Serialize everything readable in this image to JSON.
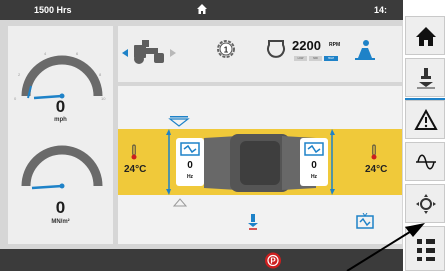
{
  "status_bar": {
    "hours": "1500 Hrs",
    "time": "14:"
  },
  "gauges": {
    "speed": {
      "value": "0",
      "unit": "mph",
      "ticks": [
        "0",
        "2",
        "4",
        "6",
        "8",
        "10"
      ]
    },
    "pressure": {
      "value": "0",
      "unit": "MN/m²"
    }
  },
  "top_panel": {
    "rpm_value": "2200",
    "rpm_unit": "RPM",
    "gear": "1",
    "speed_modes": [
      "LOW",
      "MID",
      "HIGH"
    ]
  },
  "drums": {
    "left": {
      "temp": "24°C",
      "freq": "0",
      "freq_unit": "Hz"
    },
    "right": {
      "temp": "24°C",
      "freq": "0",
      "freq_unit": "Hz"
    }
  },
  "colors": {
    "accent": "#1e82c8",
    "drum_band": "#f0c93a",
    "warning": "#cc1f1f",
    "bar": "#3b3b3b"
  },
  "sidebar": {
    "items": [
      {
        "icon": "home-icon"
      },
      {
        "icon": "spray-nozzle-icon"
      },
      {
        "icon": "warning-icon"
      },
      {
        "icon": "vibration-wave-icon"
      },
      {
        "icon": "drum-settings-icon"
      },
      {
        "icon": "menu-grid-icon"
      }
    ]
  }
}
